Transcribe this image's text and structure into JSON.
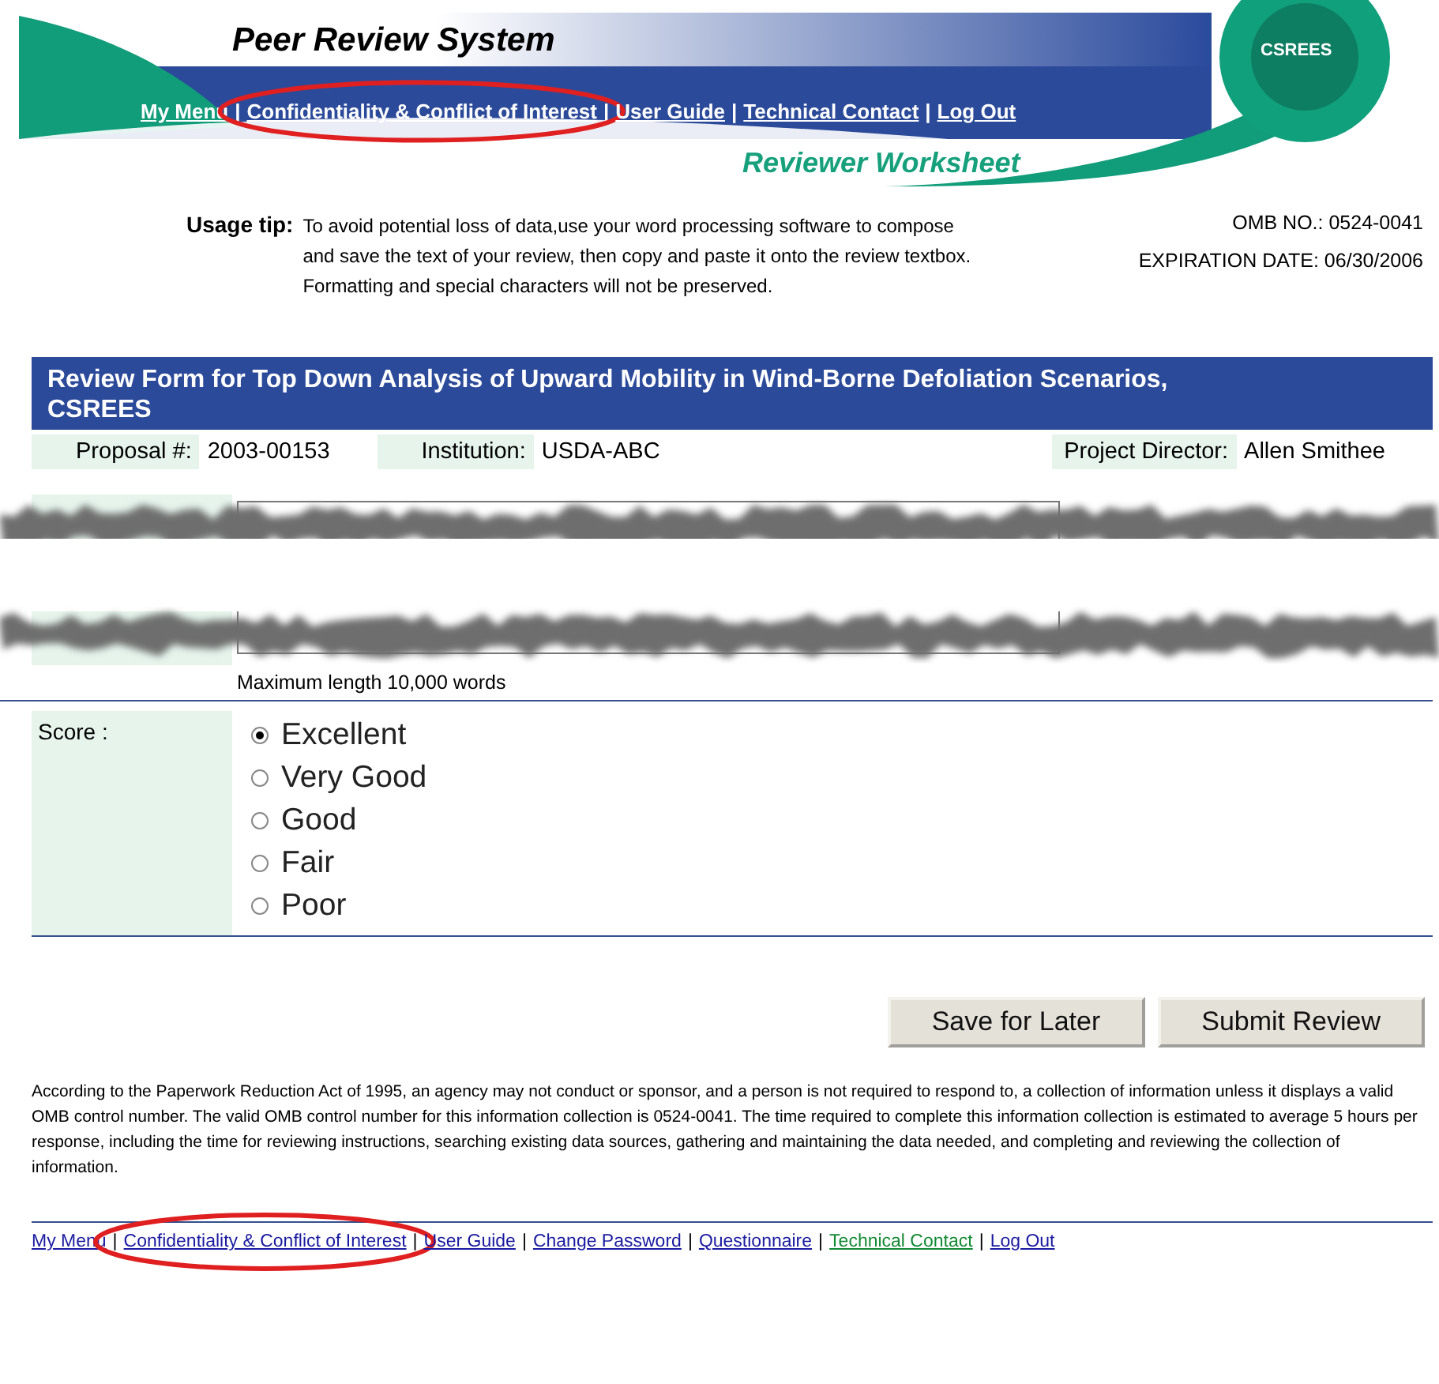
{
  "header": {
    "title": "Peer Review System",
    "subtitle": "Reviewer Worksheet",
    "logo_text": "CSREES",
    "separator": "|",
    "links": [
      {
        "label": "My Menu",
        "circled": false
      },
      {
        "label": "Confidentiality & Conflict of Interest",
        "circled": true
      },
      {
        "label": "User Guide",
        "circled": false
      },
      {
        "label": "Technical Contact",
        "circled": false
      },
      {
        "label": "Log Out",
        "circled": false
      }
    ]
  },
  "tip": {
    "label": "Usage tip:",
    "text": "To avoid potential loss of data,use your word processing software to compose and save the text of your review, then copy and paste it onto the review textbox. Formatting and special characters will not be preserved.",
    "omb": "OMB NO.: 0524-0041",
    "expiration": "EXPIRATION DATE: 06/30/2006"
  },
  "form": {
    "title": "Review Form for Top Down Analysis of Upward Mobility in Wind-Borne Defoliation Scenarios, CSREES",
    "fields": [
      {
        "label": "Proposal #:",
        "value": "2003-00153"
      },
      {
        "label": "Institution:",
        "value": "USDA-ABC"
      },
      {
        "label": "Project Director:",
        "value": "Allen Smithee"
      }
    ],
    "review_hint": "Maximum length 10,000 words",
    "score_label": "Score :",
    "scores": [
      {
        "label": "Excellent",
        "selected": true
      },
      {
        "label": "Very Good",
        "selected": false
      },
      {
        "label": "Good",
        "selected": false
      },
      {
        "label": "Fair",
        "selected": false
      },
      {
        "label": "Poor",
        "selected": false
      }
    ],
    "buttons": [
      "Save for Later",
      "Submit Review"
    ]
  },
  "notice": "According to the Paperwork Reduction Act of 1995, an agency may not conduct or sponsor, and a person is not required to respond to, a collection of information unless it displays a valid OMB control number. The valid OMB control number for this information collection is 0524-0041. The time required to complete this information collection is estimated to average 5 hours per response, including the time for reviewing instructions, searching existing data sources, gathering and maintaining the data needed, and completing and reviewing the collection of information.",
  "footer_separator": "|",
  "footer_links": [
    {
      "label": "My Menu",
      "visited": false,
      "circled": false
    },
    {
      "label": "Confidentiality & Conflict of Interest",
      "visited": false,
      "circled": true
    },
    {
      "label": "User Guide",
      "visited": false,
      "circled": false
    },
    {
      "label": "Change Password",
      "visited": false,
      "circled": false
    },
    {
      "label": "Questionnaire",
      "visited": false,
      "circled": false
    },
    {
      "label": "Technical Contact",
      "visited": true,
      "circled": false
    },
    {
      "label": "Log Out",
      "visited": false,
      "circled": false
    }
  ]
}
